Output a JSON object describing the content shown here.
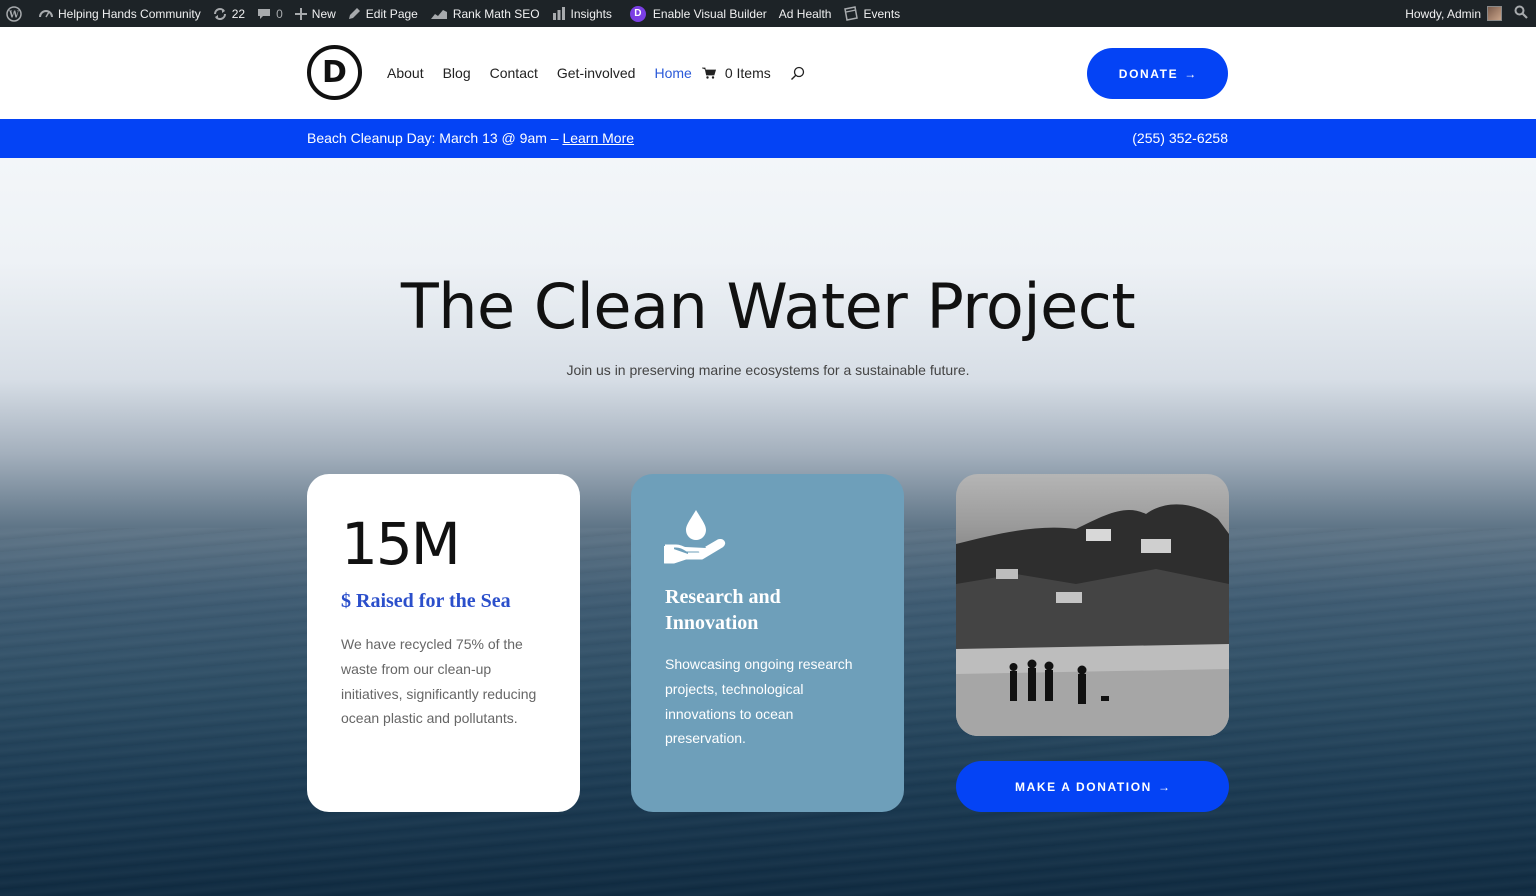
{
  "admin_bar": {
    "site_name": "Helping Hands Community",
    "updates_count": "22",
    "comments_count": "0",
    "new_label": "New",
    "edit_page_label": "Edit Page",
    "rank_math_label": "Rank Math SEO",
    "insights_label": "Insights",
    "visual_builder_label": "Enable Visual Builder",
    "ad_health_label": "Ad Health",
    "events_label": "Events",
    "howdy_label": "Howdy, Admin"
  },
  "header": {
    "logo_letter": "D",
    "nav": [
      {
        "label": "About"
      },
      {
        "label": "Blog"
      },
      {
        "label": "Contact"
      },
      {
        "label": "Get-involved"
      },
      {
        "label": "Home"
      }
    ],
    "cart_label": "0 Items",
    "donate_label": "DONATE",
    "arrow": "→"
  },
  "announcement": {
    "text": "Beach Cleanup Day: March 13 @ 9am – ",
    "link_label": "Learn More",
    "phone": "(255) 352-6258"
  },
  "hero": {
    "title": "The Clean Water Project",
    "subtitle": "Join us in preserving marine ecosystems for a sustainable future."
  },
  "cards": {
    "stat": {
      "value": "15M",
      "heading": "$ Raised for the Sea",
      "text": "We have recycled 75% of the waste from our clean-up initiatives, significantly reducing ocean plastic and pollutants."
    },
    "research": {
      "heading": "Research and Innovation",
      "text": "Showcasing ongoing research projects, technological innovations to ocean preservation."
    }
  },
  "make_donation_label": "MAKE A DONATION",
  "colors": {
    "accent": "#0443f5",
    "card_blue": "#6e9fba",
    "heading_blue": "#2b4fcb",
    "admin_bar": "#1d2327"
  }
}
